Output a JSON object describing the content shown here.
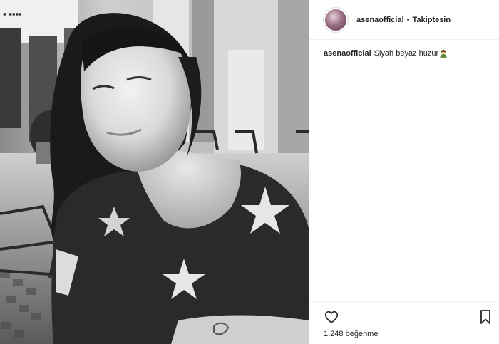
{
  "post": {
    "author": {
      "username": "asenaofficial",
      "separator": "•",
      "follow_status": "Takiptesin"
    },
    "caption": {
      "username": "asenaofficial",
      "text": "Siyah beyaz huzur",
      "emoji": "person-emoji-icon"
    },
    "actions": {
      "like_icon": "heart-icon",
      "save_icon": "bookmark-icon"
    },
    "likes": {
      "count": "1.248",
      "label": "beğenme"
    }
  }
}
